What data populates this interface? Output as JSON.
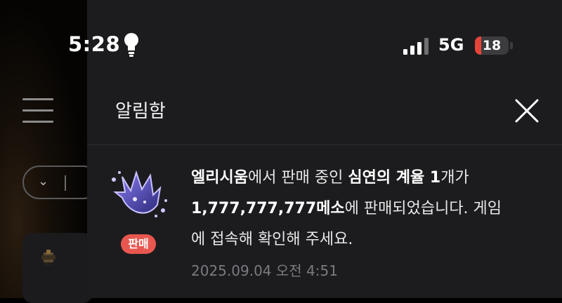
{
  "status_bar": {
    "time": "5:28",
    "network": "5G",
    "battery": "18",
    "battery_level": 0.18
  },
  "panel": {
    "title": "알림함"
  },
  "notification": {
    "badge": "판매",
    "item_name_1": "엘리시움",
    "text_1": "에서 판매 중인 ",
    "item_bold_2": "심연의 계율 1",
    "text_2": "개가",
    "price_bold": "1,777,777,777메소",
    "text_3": "에 판매되었습니다. 게임",
    "text_4": "에 접속해 확인해 주세요.",
    "timestamp": "2025.09.04 오전 4:51"
  }
}
